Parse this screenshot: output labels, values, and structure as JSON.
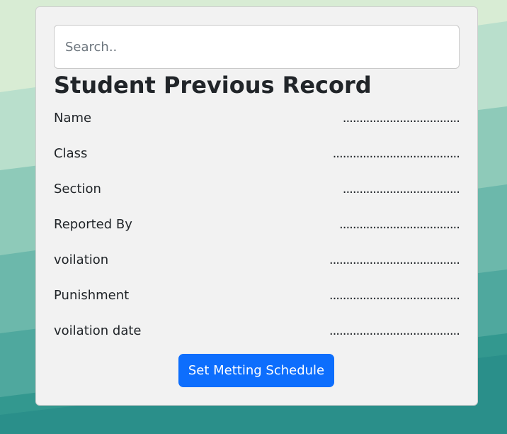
{
  "search": {
    "placeholder": "Search..",
    "value": ""
  },
  "record": {
    "title": "Student Previous Record",
    "fields": [
      {
        "label": "Name",
        "value": "..................................."
      },
      {
        "label": "Class",
        "value": "......................................"
      },
      {
        "label": "Section",
        "value": "..................................."
      },
      {
        "label": "Reported By",
        "value": "...................................."
      },
      {
        "label": "voilation",
        "value": "......................................."
      },
      {
        "label": "Punishment",
        "value": "......................................."
      },
      {
        "label": "voilation date",
        "value": "......................................."
      }
    ]
  },
  "actions": {
    "schedule_label": "Set Metting Schedule"
  },
  "colors": {
    "card_background": "#f2f2f2",
    "primary_button": "#0d6efd",
    "background_light": "#d8ecd4",
    "background_dark": "#2a948f"
  }
}
